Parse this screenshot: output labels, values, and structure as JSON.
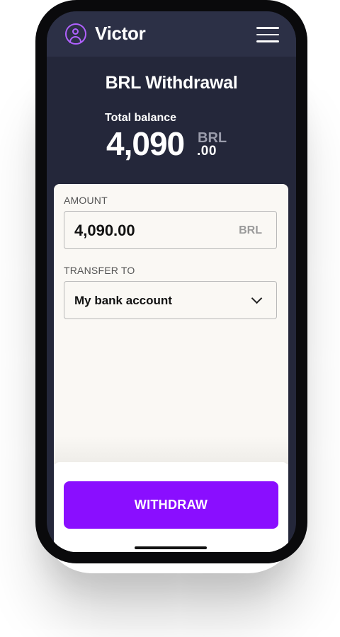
{
  "header": {
    "username": "Victor",
    "avatar_icon": "user-circle-icon",
    "menu_icon": "hamburger-menu-icon"
  },
  "page": {
    "title": "BRL Withdrawal"
  },
  "balance": {
    "label": "Total balance",
    "integer": "4,090",
    "currency": "BRL",
    "cents": ".00"
  },
  "form": {
    "amount_label": "AMOUNT",
    "amount_value": "4,090.00",
    "amount_currency": "BRL",
    "transfer_label": "TRANSFER TO",
    "transfer_value": "My bank account",
    "transfer_icon": "chevron-down-icon"
  },
  "actions": {
    "withdraw_label": "WITHDRAW"
  },
  "colors": {
    "accent": "#8a0eff",
    "avatar": "#b061ff",
    "header_bg": "#2c3046",
    "screen_bg": "#24273a"
  }
}
